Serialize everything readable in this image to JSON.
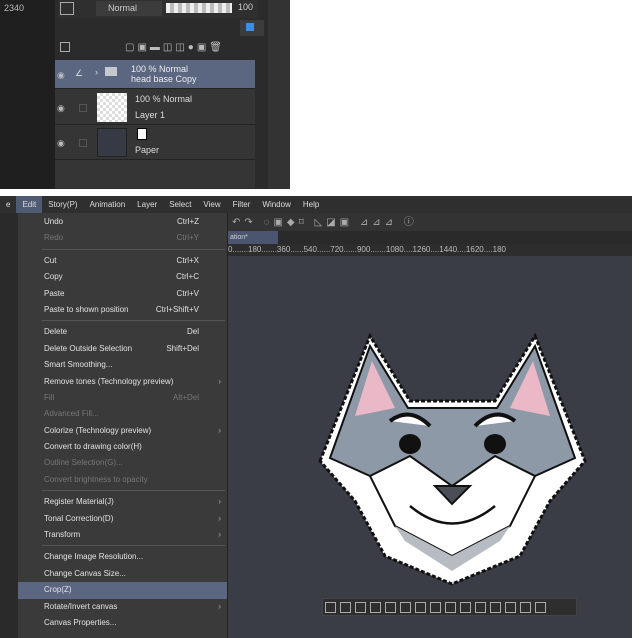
{
  "layers_panel": {
    "ruler_text": "2340",
    "blend_mode": "Normal",
    "opacity": "100",
    "layers": [
      {
        "mode": "100 % Normal",
        "name": "head base Copy",
        "type": "folder",
        "selected": true
      },
      {
        "mode": "100 % Normal",
        "name": "Layer 1",
        "type": "raster",
        "selected": false
      },
      {
        "mode": "",
        "name": "Paper",
        "type": "paper",
        "selected": false
      }
    ]
  },
  "menubar": [
    "e",
    "Edit",
    "Story(P)",
    "Animation",
    "Layer",
    "Select",
    "View",
    "Filter",
    "Window",
    "Help"
  ],
  "active_menu": "Edit",
  "tab_title": "ation*",
  "ruler": "0.......180.......360......540......720......900.......1080....1260....1440....1620....180",
  "edit_menu": [
    {
      "label": "Undo",
      "shortcut": "Ctrl+Z"
    },
    {
      "label": "Redo",
      "shortcut": "Ctrl+Y",
      "disabled": true
    },
    {
      "sep": true
    },
    {
      "label": "Cut",
      "shortcut": "Ctrl+X"
    },
    {
      "label": "Copy",
      "shortcut": "Ctrl+C"
    },
    {
      "label": "Paste",
      "shortcut": "Ctrl+V"
    },
    {
      "label": "Paste to shown position",
      "shortcut": "Ctrl+Shift+V"
    },
    {
      "sep": true
    },
    {
      "label": "Delete",
      "shortcut": "Del"
    },
    {
      "label": "Delete Outside Selection",
      "shortcut": "Shift+Del"
    },
    {
      "label": "Smart Smoothing..."
    },
    {
      "label": "Remove tones (Technology preview)",
      "submenu": true
    },
    {
      "label": "Fill",
      "shortcut": "Alt+Del",
      "disabled": true
    },
    {
      "label": "Advanced Fill...",
      "disabled": true
    },
    {
      "label": "Colorize (Technology preview)",
      "submenu": true
    },
    {
      "label": "Convert to drawing color(H)"
    },
    {
      "label": "Outline Selection(G)...",
      "disabled": true
    },
    {
      "label": "Convert brightness to opacity",
      "disabled": true
    },
    {
      "sep": true
    },
    {
      "label": "Register Material(J)",
      "submenu": true
    },
    {
      "label": "Tonal Correction(D)",
      "submenu": true
    },
    {
      "label": "Transform",
      "submenu": true
    },
    {
      "sep": true
    },
    {
      "label": "Change Image Resolution..."
    },
    {
      "label": "Change Canvas Size..."
    },
    {
      "label": "Crop(Z)",
      "highlighted": true
    },
    {
      "label": "Rotate/Invert canvas",
      "submenu": true
    },
    {
      "label": "Canvas Properties..."
    }
  ],
  "colors": {
    "accent": "#5b6681",
    "canvas": "#3a3d45"
  }
}
